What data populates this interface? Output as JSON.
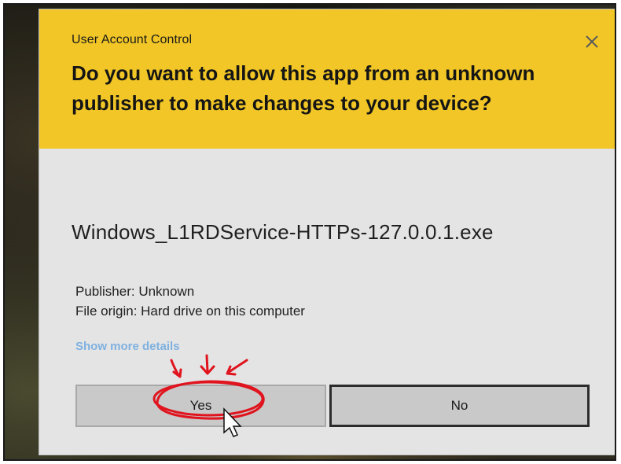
{
  "dialog": {
    "header_title": "User Account Control",
    "question": "Do you want to allow this app from an unknown publisher to make changes to your device?",
    "app_name": "Windows_L1RDService-HTTPs-127.0.0.1.exe",
    "publisher": "Publisher: Unknown",
    "file_origin": "File origin: Hard drive on this computer",
    "details_link": "Show more details",
    "yes_label": "Yes",
    "no_label": "No",
    "close_icon": "close-icon"
  },
  "colors": {
    "header": "#f1c626",
    "body": "#e4e4e4",
    "link": "#7fb1e0",
    "annotation": "#e0141e"
  }
}
